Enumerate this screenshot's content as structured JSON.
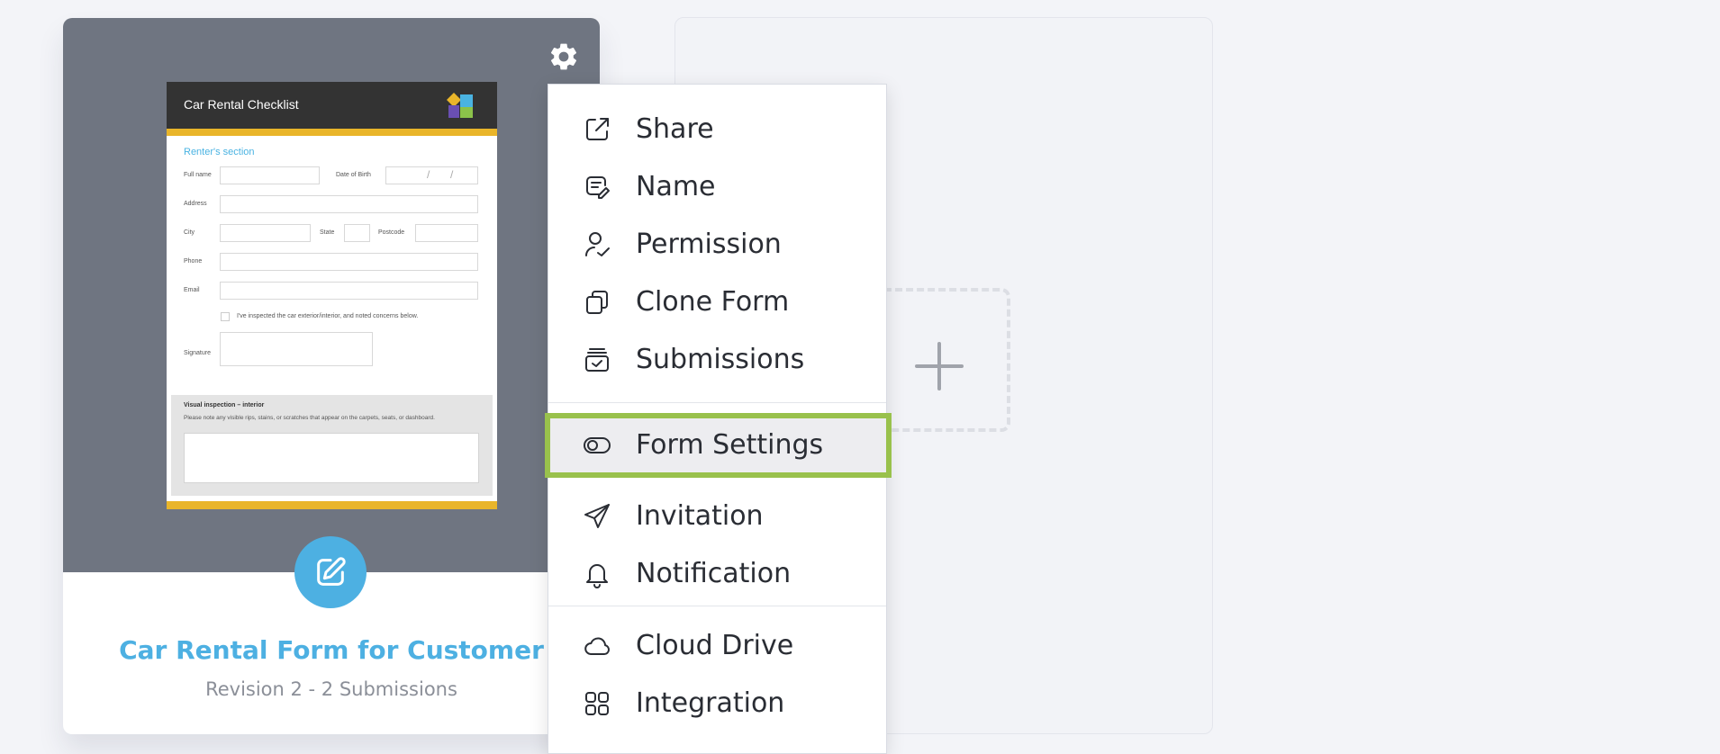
{
  "form_card": {
    "preview": {
      "title": "Car Rental Checklist",
      "section": "Renter's section",
      "fields": {
        "full_name": "Full name",
        "dob": "Date of Birth",
        "address": "Address",
        "city": "City",
        "state": "State",
        "postcode": "Postcode",
        "phone": "Phone",
        "email": "Email"
      },
      "checkbox_text": "I've inspected the car exterior/interior, and noted concerns below.",
      "signature": "Signature",
      "visual_title": "Visual inspection – interior",
      "visual_text": "Please note any visible rips, stains, or scratches that appear on the carpets, seats, or dashboard.",
      "dob_slash": "/"
    },
    "name": "Car Rental Form for Customer",
    "meta": "Revision 2 - 2 Submissions"
  },
  "menu": {
    "share": "Share",
    "name": "Name",
    "permission": "Permission",
    "clone": "Clone Form",
    "submissions": "Submissions",
    "form_settings": "Form Settings",
    "invitation": "Invitation",
    "notification": "Notification",
    "cloud_drive": "Cloud Drive",
    "integration": "Integration"
  },
  "colors": {
    "accent": "#4db0e2",
    "highlight_border": "#99c14c",
    "card_top": "#6f7581",
    "preview_band": "#e9b52a"
  },
  "icons": {
    "gear": "gear-icon",
    "edit": "edit-icon",
    "plus": "plus-icon"
  }
}
